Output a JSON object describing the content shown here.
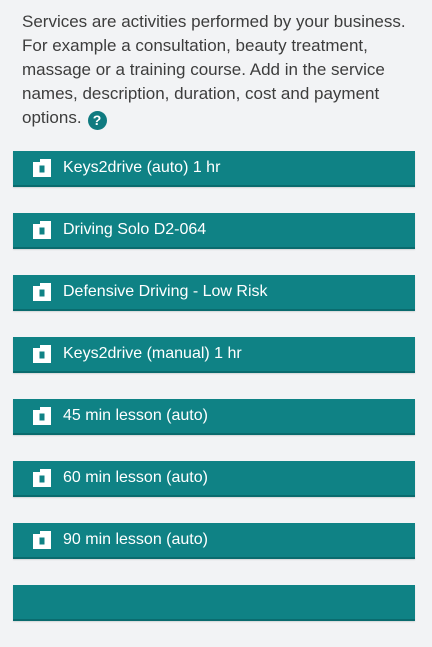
{
  "intro": {
    "text": "Services are activities performed by your business. For example a consultation, beauty treatment, massage or a training course. Add in the service names, description, duration, cost and payment options.",
    "help_icon": "?"
  },
  "services": [
    {
      "label": "Keys2drive (auto) 1 hr",
      "icon": "service-icon"
    },
    {
      "label": "Driving Solo D2-064",
      "icon": "service-icon"
    },
    {
      "label": "Defensive Driving - Low Risk",
      "icon": "service-icon"
    },
    {
      "label": "Keys2drive (manual) 1 hr",
      "icon": "service-icon"
    },
    {
      "label": "45 min lesson (auto)",
      "icon": "service-icon"
    },
    {
      "label": "60 min lesson (auto)",
      "icon": "service-icon"
    },
    {
      "label": "90 min lesson (auto)",
      "icon": "service-icon"
    },
    {
      "label": "",
      "icon": "service-icon"
    }
  ],
  "colors": {
    "row_background": "#0f8285",
    "help_icon": "#0f7a80",
    "page_background": "#f2f3f5"
  }
}
